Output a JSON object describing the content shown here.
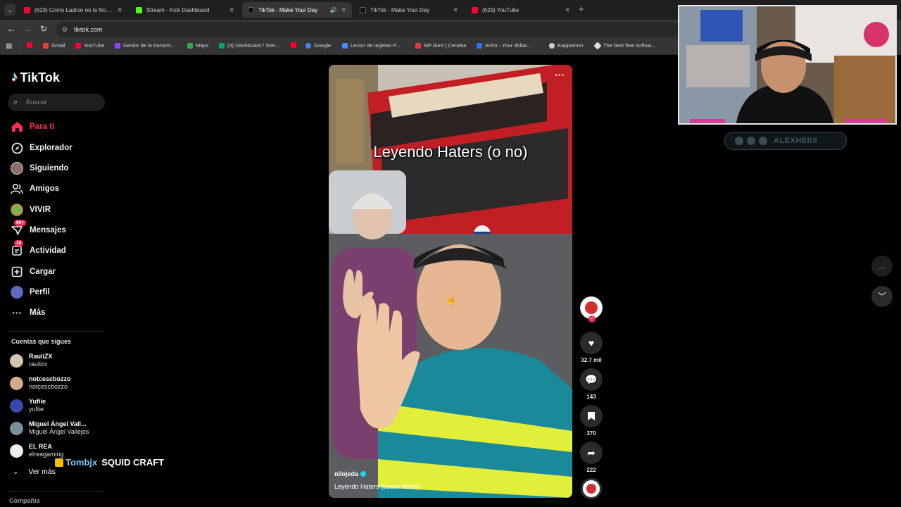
{
  "browser": {
    "tabs": [
      {
        "title": "(629) Como Ladron en la Noche",
        "color": "#ff0033",
        "active": false
      },
      {
        "title": "Stream - Kick Dashboard",
        "color": "#53fc18",
        "active": false
      },
      {
        "title": "TikTok - Make Your Day",
        "color": "#000000",
        "active": true
      },
      {
        "title": "TikTok - Make Your Day",
        "color": "#000000",
        "active": false
      },
      {
        "title": "(629) YouTube",
        "color": "#ff0033",
        "active": false
      }
    ],
    "url": "tiktok.com",
    "bookmarks": [
      "",
      "Gmail",
      "YouTube",
      "Gestor de la transmi...",
      "Maps",
      "(3) Dashboard / Stre...",
      "",
      "Google",
      "Lector de tarjetas P...",
      "MP Alert | Ceneka",
      "Airtm - Your dollar...",
      "Kappamon",
      "The best free softwa..."
    ]
  },
  "sidebar": {
    "logo": "TikTok",
    "search_placeholder": "Buscar",
    "nav": [
      {
        "label": "Para ti",
        "icon": "home-icon",
        "active": true
      },
      {
        "label": "Explorador",
        "icon": "compass-icon"
      },
      {
        "label": "Siguiendo",
        "icon": "following-avatar"
      },
      {
        "label": "Amigos",
        "icon": "friends-icon"
      },
      {
        "label": "VIVIR",
        "icon": "live-avatar"
      },
      {
        "label": "Mensajes",
        "icon": "messages-icon",
        "badge": "99+"
      },
      {
        "label": "Actividad",
        "icon": "activity-icon",
        "badge": "16"
      },
      {
        "label": "Cargar",
        "icon": "upload-icon"
      },
      {
        "label": "Perfil",
        "icon": "profile-avatar"
      },
      {
        "label": "Más",
        "icon": "more-icon"
      }
    ],
    "following_title": "Cuentas que sigues",
    "following": [
      {
        "name": "RauliZX",
        "handle": "raulizx"
      },
      {
        "name": "notcescbozzo",
        "handle": "notcescbozzo"
      },
      {
        "name": "Yufiie",
        "handle": "yufiie"
      },
      {
        "name": "Miguel Ángel Vall...",
        "handle": "Miguel Ángel Vallejos"
      },
      {
        "name": "EL REA",
        "handle": "elreagaming"
      }
    ],
    "see_more": "Ver más",
    "company": "Compañía"
  },
  "stream_overlay": {
    "viewer_name": "Tombjx",
    "game": "SQUID CRAFT",
    "channel": "ALEXHEIIS"
  },
  "video": {
    "caption": "Leyendo Haters (o no)",
    "author": "nilojeda",
    "description": "Leyendo Haters (busco editor)",
    "likes": "32.7 mil",
    "comments": "143",
    "saves": "370",
    "shares": "222"
  }
}
